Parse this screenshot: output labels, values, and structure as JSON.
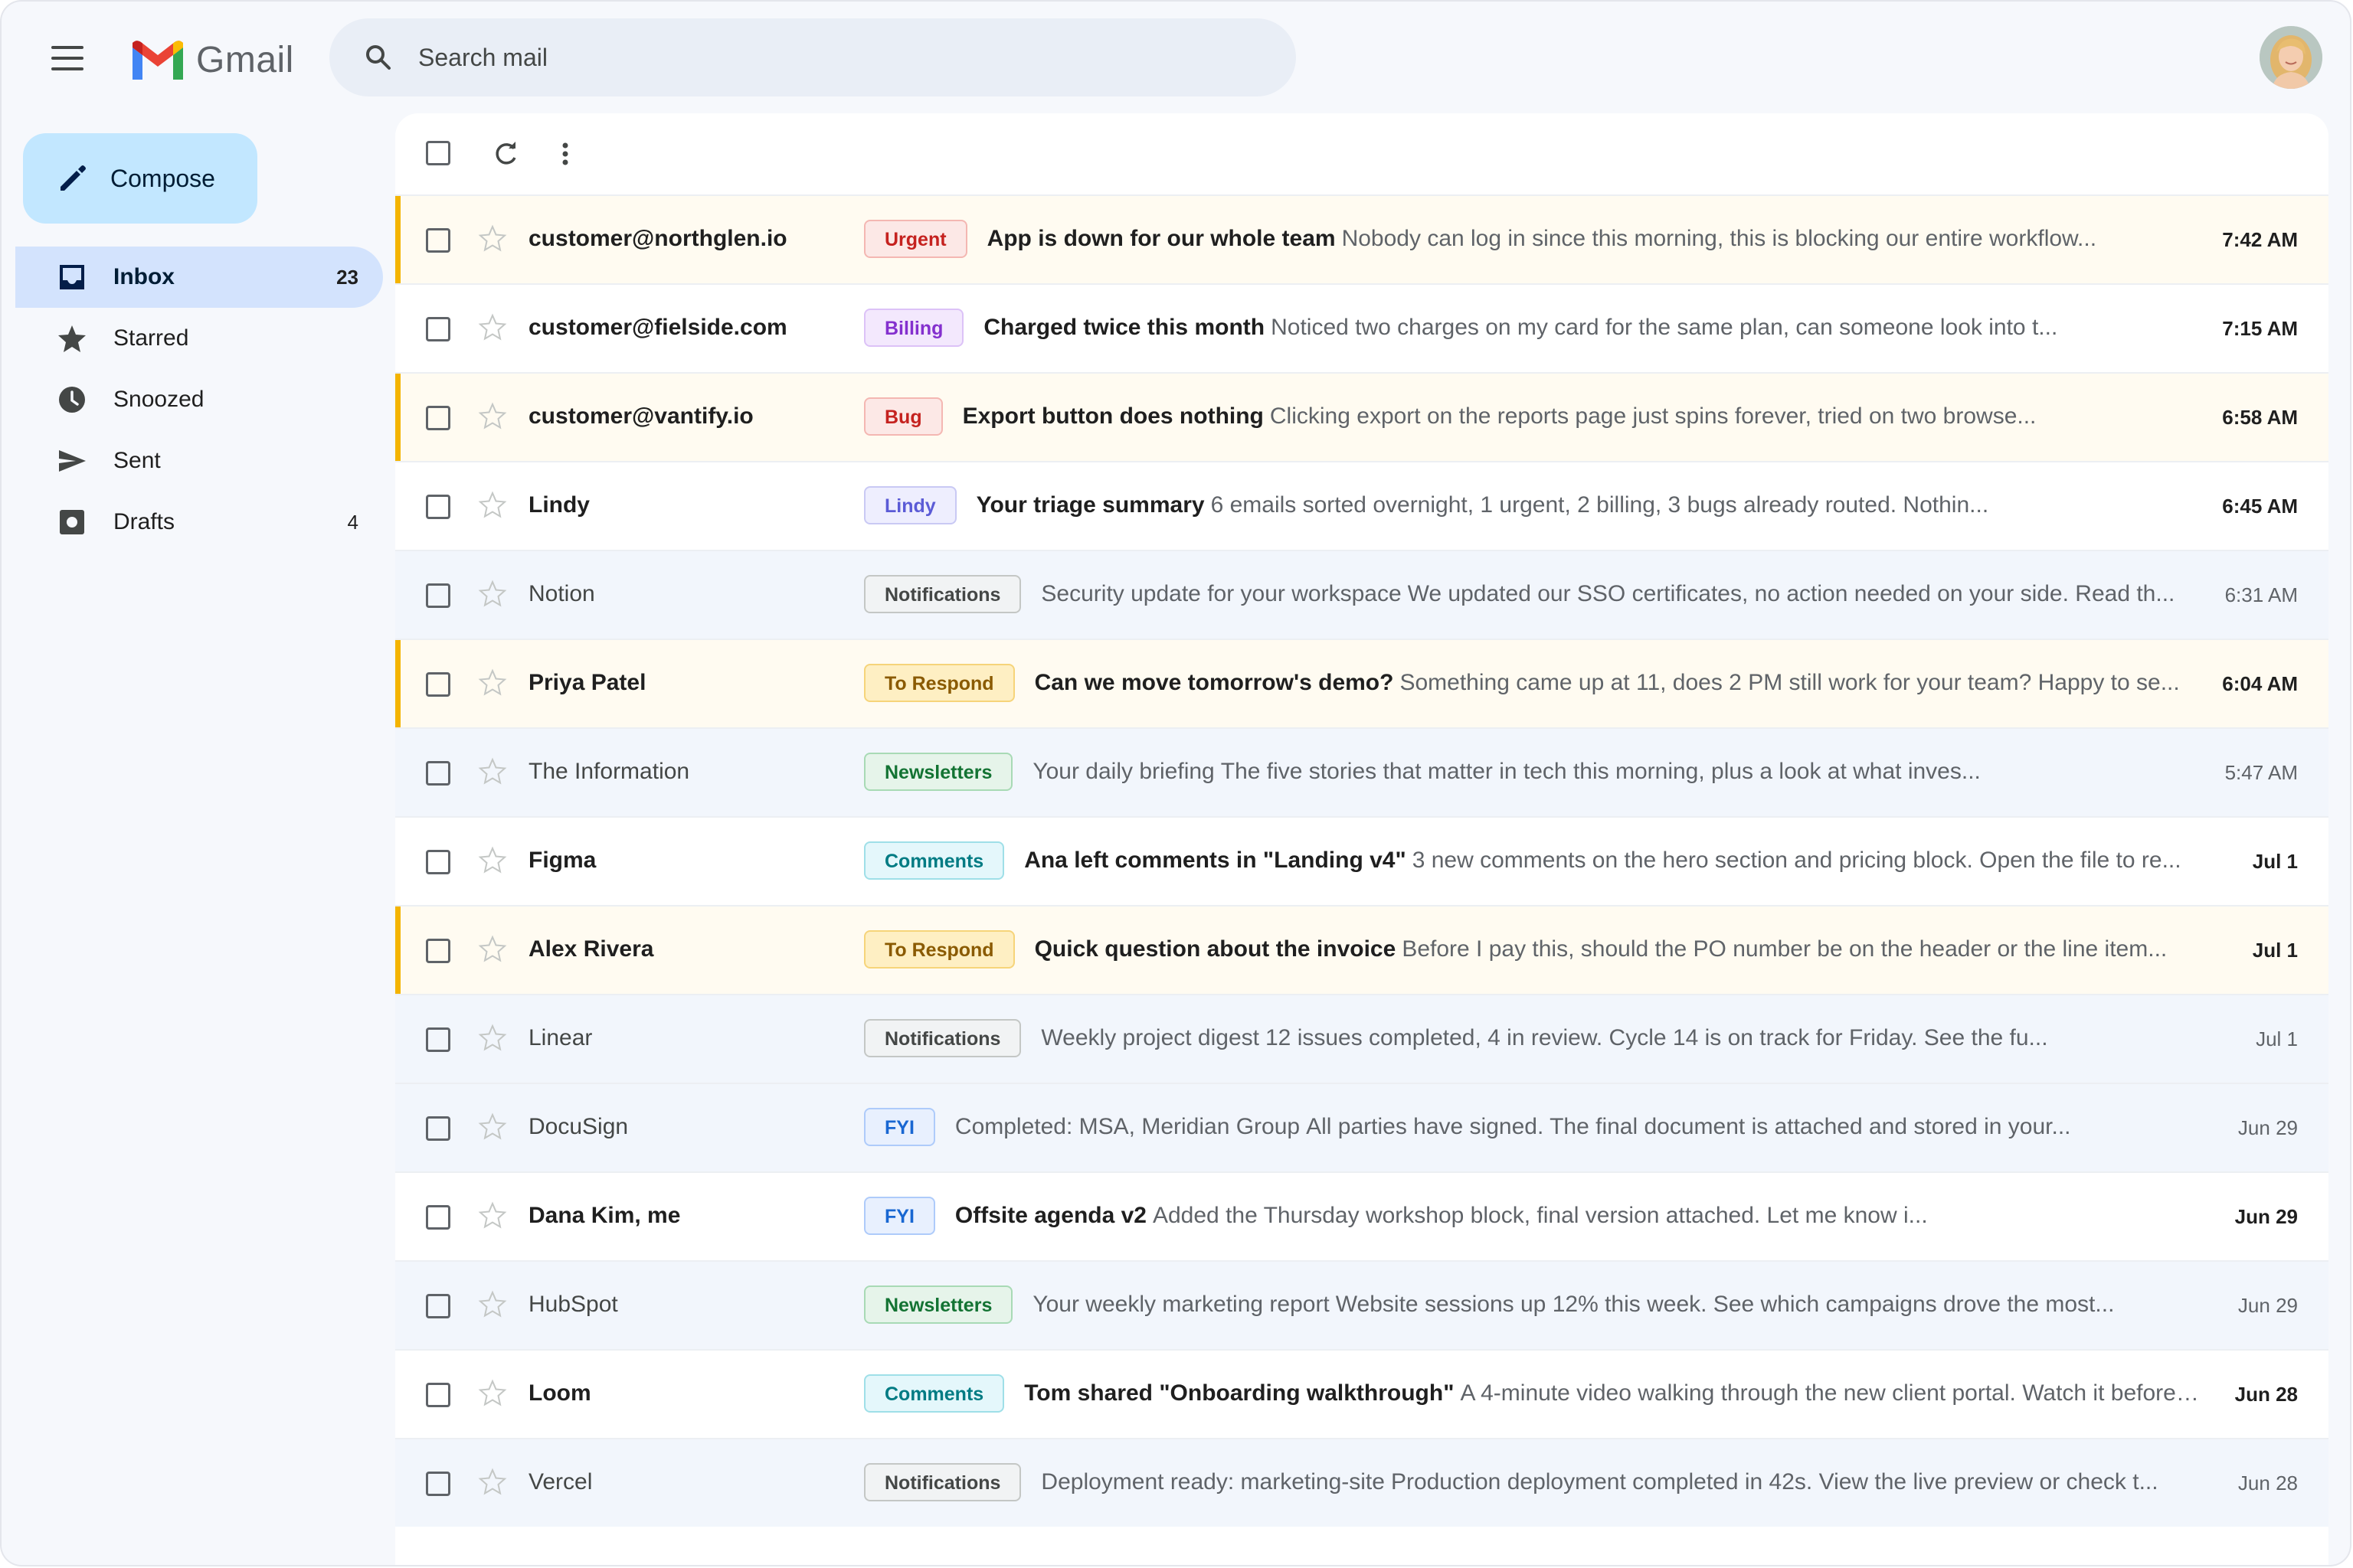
{
  "app": {
    "name": "Gmail",
    "brand_colors": {
      "blue": "#4285f4",
      "red": "#ea4335",
      "yellow": "#fbbc04",
      "green": "#34a853"
    }
  },
  "header": {
    "menu_icon": "hamburger-menu-icon",
    "search_placeholder": "Search mail",
    "search_icon": "search-icon",
    "avatar_icon": "user-avatar"
  },
  "sidebar": {
    "compose_label": "Compose",
    "compose_icon": "pencil-icon",
    "items": [
      {
        "label": "Inbox",
        "count": "23",
        "icon": "inbox-icon",
        "active": true
      },
      {
        "label": "Starred",
        "count": "",
        "icon": "star-icon",
        "active": false
      },
      {
        "label": "Snoozed",
        "count": "",
        "icon": "clock-icon",
        "active": false
      },
      {
        "label": "Sent",
        "count": "",
        "icon": "send-icon",
        "active": false
      },
      {
        "label": "Drafts",
        "count": "4",
        "icon": "draft-icon",
        "active": false
      }
    ]
  },
  "toolbar": {
    "icons": [
      "select-all-checkbox",
      "refresh-icon",
      "more-vert-icon"
    ]
  },
  "label_styles": {
    "Urgent": {
      "fg": "#c5221f",
      "bg": "#fce8e6",
      "border": "#f4b7b2"
    },
    "Billing": {
      "fg": "#8430ce",
      "bg": "#f3e8fd",
      "border": "#dcc2f7"
    },
    "Bug": {
      "fg": "#c5221f",
      "bg": "#fce8e6",
      "border": "#f4b7b2"
    },
    "Lindy": {
      "fg": "#5b5bd6",
      "bg": "#eeeefe",
      "border": "#c9c9f4"
    },
    "Notifications": {
      "fg": "#444746",
      "bg": "#f1f3f4",
      "border": "#c4c7c5"
    },
    "To Respond": {
      "fg": "#8a5a00",
      "bg": "#feefc3",
      "border": "#f6d47a"
    },
    "Newsletters": {
      "fg": "#137333",
      "bg": "#e6f4ea",
      "border": "#a8dab5"
    },
    "Comments": {
      "fg": "#007b83",
      "bg": "#e4f7fb",
      "border": "#9fdfe8"
    },
    "FYI": {
      "fg": "#1967d2",
      "bg": "#e8f0fe",
      "border": "#aecbfa"
    }
  },
  "emails": [
    {
      "sender": "customer@northglen.io",
      "label": "Urgent",
      "subject": "App is down for our whole team",
      "snippet": "Nobody can log in since this morning, this is blocking our entire workflow...",
      "time": "7:42 AM",
      "unread": true,
      "flagged": true
    },
    {
      "sender": "customer@fielside.com",
      "label": "Billing",
      "subject": "Charged twice this month",
      "snippet": "Noticed two charges on my card for the same plan, can someone look into t...",
      "time": "7:15 AM",
      "unread": true,
      "flagged": false
    },
    {
      "sender": "customer@vantify.io",
      "label": "Bug",
      "subject": "Export button does nothing",
      "snippet": "Clicking export on the reports page just spins forever, tried on two browse...",
      "time": "6:58 AM",
      "unread": true,
      "flagged": true
    },
    {
      "sender": "Lindy",
      "label": "Lindy",
      "subject": "Your triage summary",
      "snippet": "6 emails sorted overnight, 1 urgent, 2 billing, 3 bugs already routed. Nothin...",
      "time": "6:45 AM",
      "unread": true,
      "flagged": false
    },
    {
      "sender": "Notion",
      "label": "Notifications",
      "subject": "Security update for your workspace",
      "snippet": "We updated our SSO certificates, no action needed on your side. Read th...",
      "time": "6:31 AM",
      "unread": false,
      "flagged": false
    },
    {
      "sender": "Priya Patel",
      "label": "To Respond",
      "subject": "Can we move tomorrow's demo?",
      "snippet": "Something came up at 11, does 2 PM still work for your team? Happy to se...",
      "time": "6:04 AM",
      "unread": true,
      "flagged": true
    },
    {
      "sender": "The Information",
      "label": "Newsletters",
      "subject": "Your daily briefing",
      "snippet": "The five stories that matter in tech this morning, plus a look at what inves...",
      "time": "5:47 AM",
      "unread": false,
      "flagged": false
    },
    {
      "sender": "Figma",
      "label": "Comments",
      "subject": "Ana left comments in \"Landing v4\"",
      "snippet": "3 new comments on the hero section and pricing block. Open the file to re...",
      "time": "Jul 1",
      "unread": true,
      "flagged": false
    },
    {
      "sender": "Alex Rivera",
      "label": "To Respond",
      "subject": "Quick question about the invoice",
      "snippet": "Before I pay this, should the PO number be on the header or the line item...",
      "time": "Jul 1",
      "unread": true,
      "flagged": true
    },
    {
      "sender": "Linear",
      "label": "Notifications",
      "subject": "Weekly project digest",
      "snippet": "12 issues completed, 4 in review. Cycle 14 is on track for Friday. See the fu...",
      "time": "Jul 1",
      "unread": false,
      "flagged": false
    },
    {
      "sender": "DocuSign",
      "label": "FYI",
      "subject": "Completed: MSA, Meridian Group",
      "snippet": "All parties have signed. The final document is attached and stored in your...",
      "time": "Jun 29",
      "unread": false,
      "flagged": false
    },
    {
      "sender": "Dana Kim, me",
      "label": "FYI",
      "subject": "Offsite agenda v2",
      "snippet": "Added the Thursday workshop block, final version attached. Let me know i...",
      "time": "Jun 29",
      "unread": true,
      "flagged": false
    },
    {
      "sender": "HubSpot",
      "label": "Newsletters",
      "subject": "Your weekly marketing report",
      "snippet": "Website sessions up 12% this week. See which campaigns drove the most...",
      "time": "Jun 29",
      "unread": false,
      "flagged": false
    },
    {
      "sender": "Loom",
      "label": "Comments",
      "subject": "Tom shared \"Onboarding walkthrough\"",
      "snippet": "A 4-minute video walking through the new client portal. Watch it before ...",
      "time": "Jun 28",
      "unread": true,
      "flagged": false
    },
    {
      "sender": "Vercel",
      "label": "Notifications",
      "subject": "Deployment ready: marketing-site",
      "snippet": "Production deployment completed in 42s. View the live preview or check t...",
      "time": "Jun 28",
      "unread": false,
      "flagged": false
    }
  ]
}
